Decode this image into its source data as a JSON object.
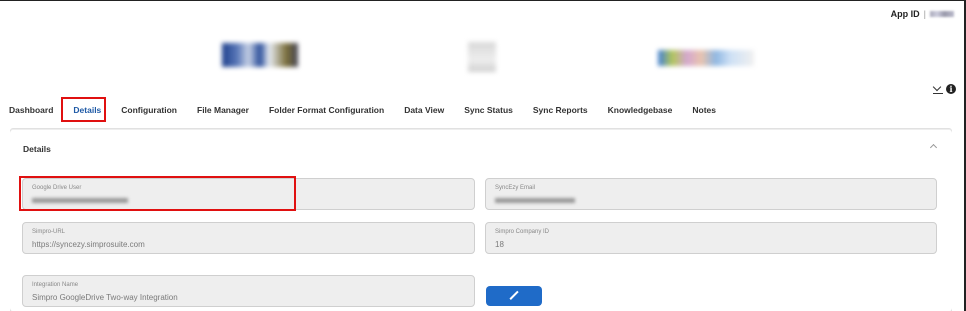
{
  "header": {
    "app_id_label": "App ID",
    "app_id_separator": "|"
  },
  "tabs": [
    {
      "label": "Dashboard",
      "active": false
    },
    {
      "label": "Details",
      "active": true
    },
    {
      "label": "Configuration",
      "active": false
    },
    {
      "label": "File Manager",
      "active": false
    },
    {
      "label": "Folder Format Configuration",
      "active": false
    },
    {
      "label": "Data View",
      "active": false
    },
    {
      "label": "Sync Status",
      "active": false
    },
    {
      "label": "Sync Reports",
      "active": false
    },
    {
      "label": "Knowledgebase",
      "active": false
    },
    {
      "label": "Notes",
      "active": false
    }
  ],
  "details": {
    "title": "Details",
    "fields": {
      "google_drive_user": {
        "label": "Google Drive User"
      },
      "syncezy_email": {
        "label": "SyncEzy Email"
      },
      "simpro_url": {
        "label": "Simpro-URL",
        "value": "https://syncezy.simprosuite.com"
      },
      "simpro_company_id": {
        "label": "Simpro Company ID",
        "value": "18"
      },
      "integration_name": {
        "label": "Integration Name",
        "value": "Simpro GoogleDrive Two-way Integration"
      }
    }
  },
  "icons": {
    "collapse": "collapse-download-icon",
    "info": "info-icon",
    "panel_toggle": "chevron-up-icon",
    "edit": "pencil-icon"
  },
  "colors": {
    "accent": "#1f6bc8",
    "active_tab": "#1f5aa6",
    "highlight": "#e01010"
  }
}
